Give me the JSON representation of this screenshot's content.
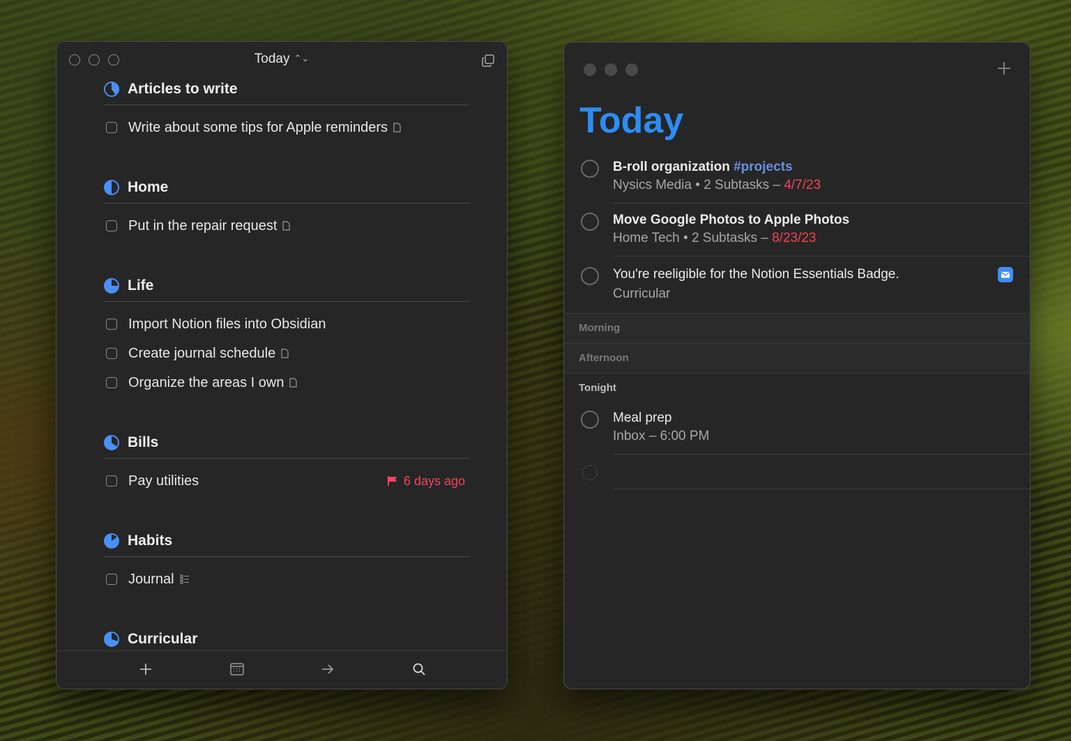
{
  "left_window": {
    "title": "Today",
    "sections": [
      {
        "title": "Articles to write",
        "items": [
          {
            "label": "Write about some tips for Apple reminders",
            "has_note": true
          }
        ]
      },
      {
        "title": "Home",
        "items": [
          {
            "label": "Put in the repair request",
            "has_note": true
          }
        ]
      },
      {
        "title": "Life",
        "items": [
          {
            "label": "Import Notion files into Obsidian",
            "has_note": false
          },
          {
            "label": "Create journal schedule",
            "has_note": true
          },
          {
            "label": "Organize the areas I own",
            "has_note": true
          }
        ]
      },
      {
        "title": "Bills",
        "items": [
          {
            "label": "Pay utilities",
            "flag": "6 days ago"
          }
        ]
      },
      {
        "title": "Habits",
        "items": [
          {
            "label": "Journal",
            "has_checklist": true
          }
        ]
      },
      {
        "title": "Curricular",
        "items": []
      }
    ],
    "toolbar_icons": [
      "plus-icon",
      "calendar-icon",
      "arrow-right-icon",
      "search-icon"
    ]
  },
  "right_window": {
    "title": "Today",
    "tasks": [
      {
        "title": "B-roll organization",
        "tag": "#projects",
        "meta": "Nysics Media • 2 Subtasks – ",
        "date": "4/7/23"
      },
      {
        "title": "Move Google Photos to Apple Photos",
        "meta": "Home Tech • 2 Subtasks – ",
        "date": "8/23/23"
      },
      {
        "title": "You're reeligible for the Notion Essentials Badge.",
        "meta": "Curricular",
        "has_mail": true
      }
    ],
    "bands": [
      "Morning",
      "Afternoon",
      "Tonight"
    ],
    "tonight_task": {
      "title": "Meal prep",
      "meta": "Inbox – 6:00 PM"
    }
  },
  "colors": {
    "accent": "#2e8cf5",
    "flag_red": "#f0455a",
    "tag_blue": "#6b8fe0"
  }
}
